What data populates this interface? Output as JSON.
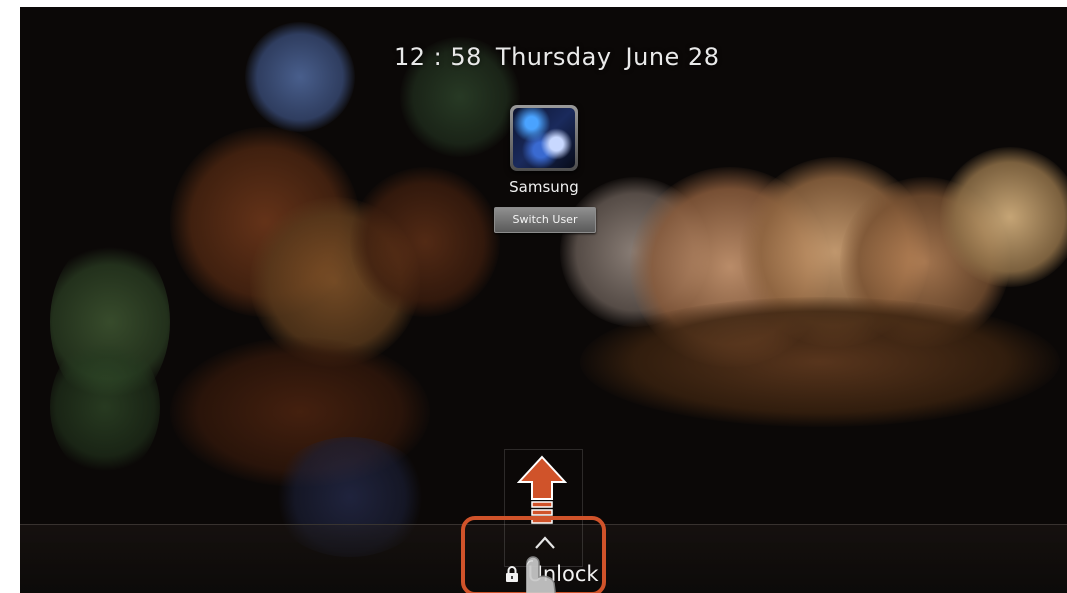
{
  "lock_screen": {
    "time": "12 : 58",
    "day": "Thursday",
    "date": "June 28",
    "user_name": "Samsung",
    "switch_user_label": "Switch User",
    "unlock_label": "Unlock"
  },
  "colors": {
    "highlight": "#d0532a",
    "background": "#0b0807",
    "text": "#f0f0f0"
  },
  "icons": [
    "lock-icon",
    "chevron-up-icon",
    "swipe-up-arrow-icon",
    "hand-pointer-icon"
  ]
}
